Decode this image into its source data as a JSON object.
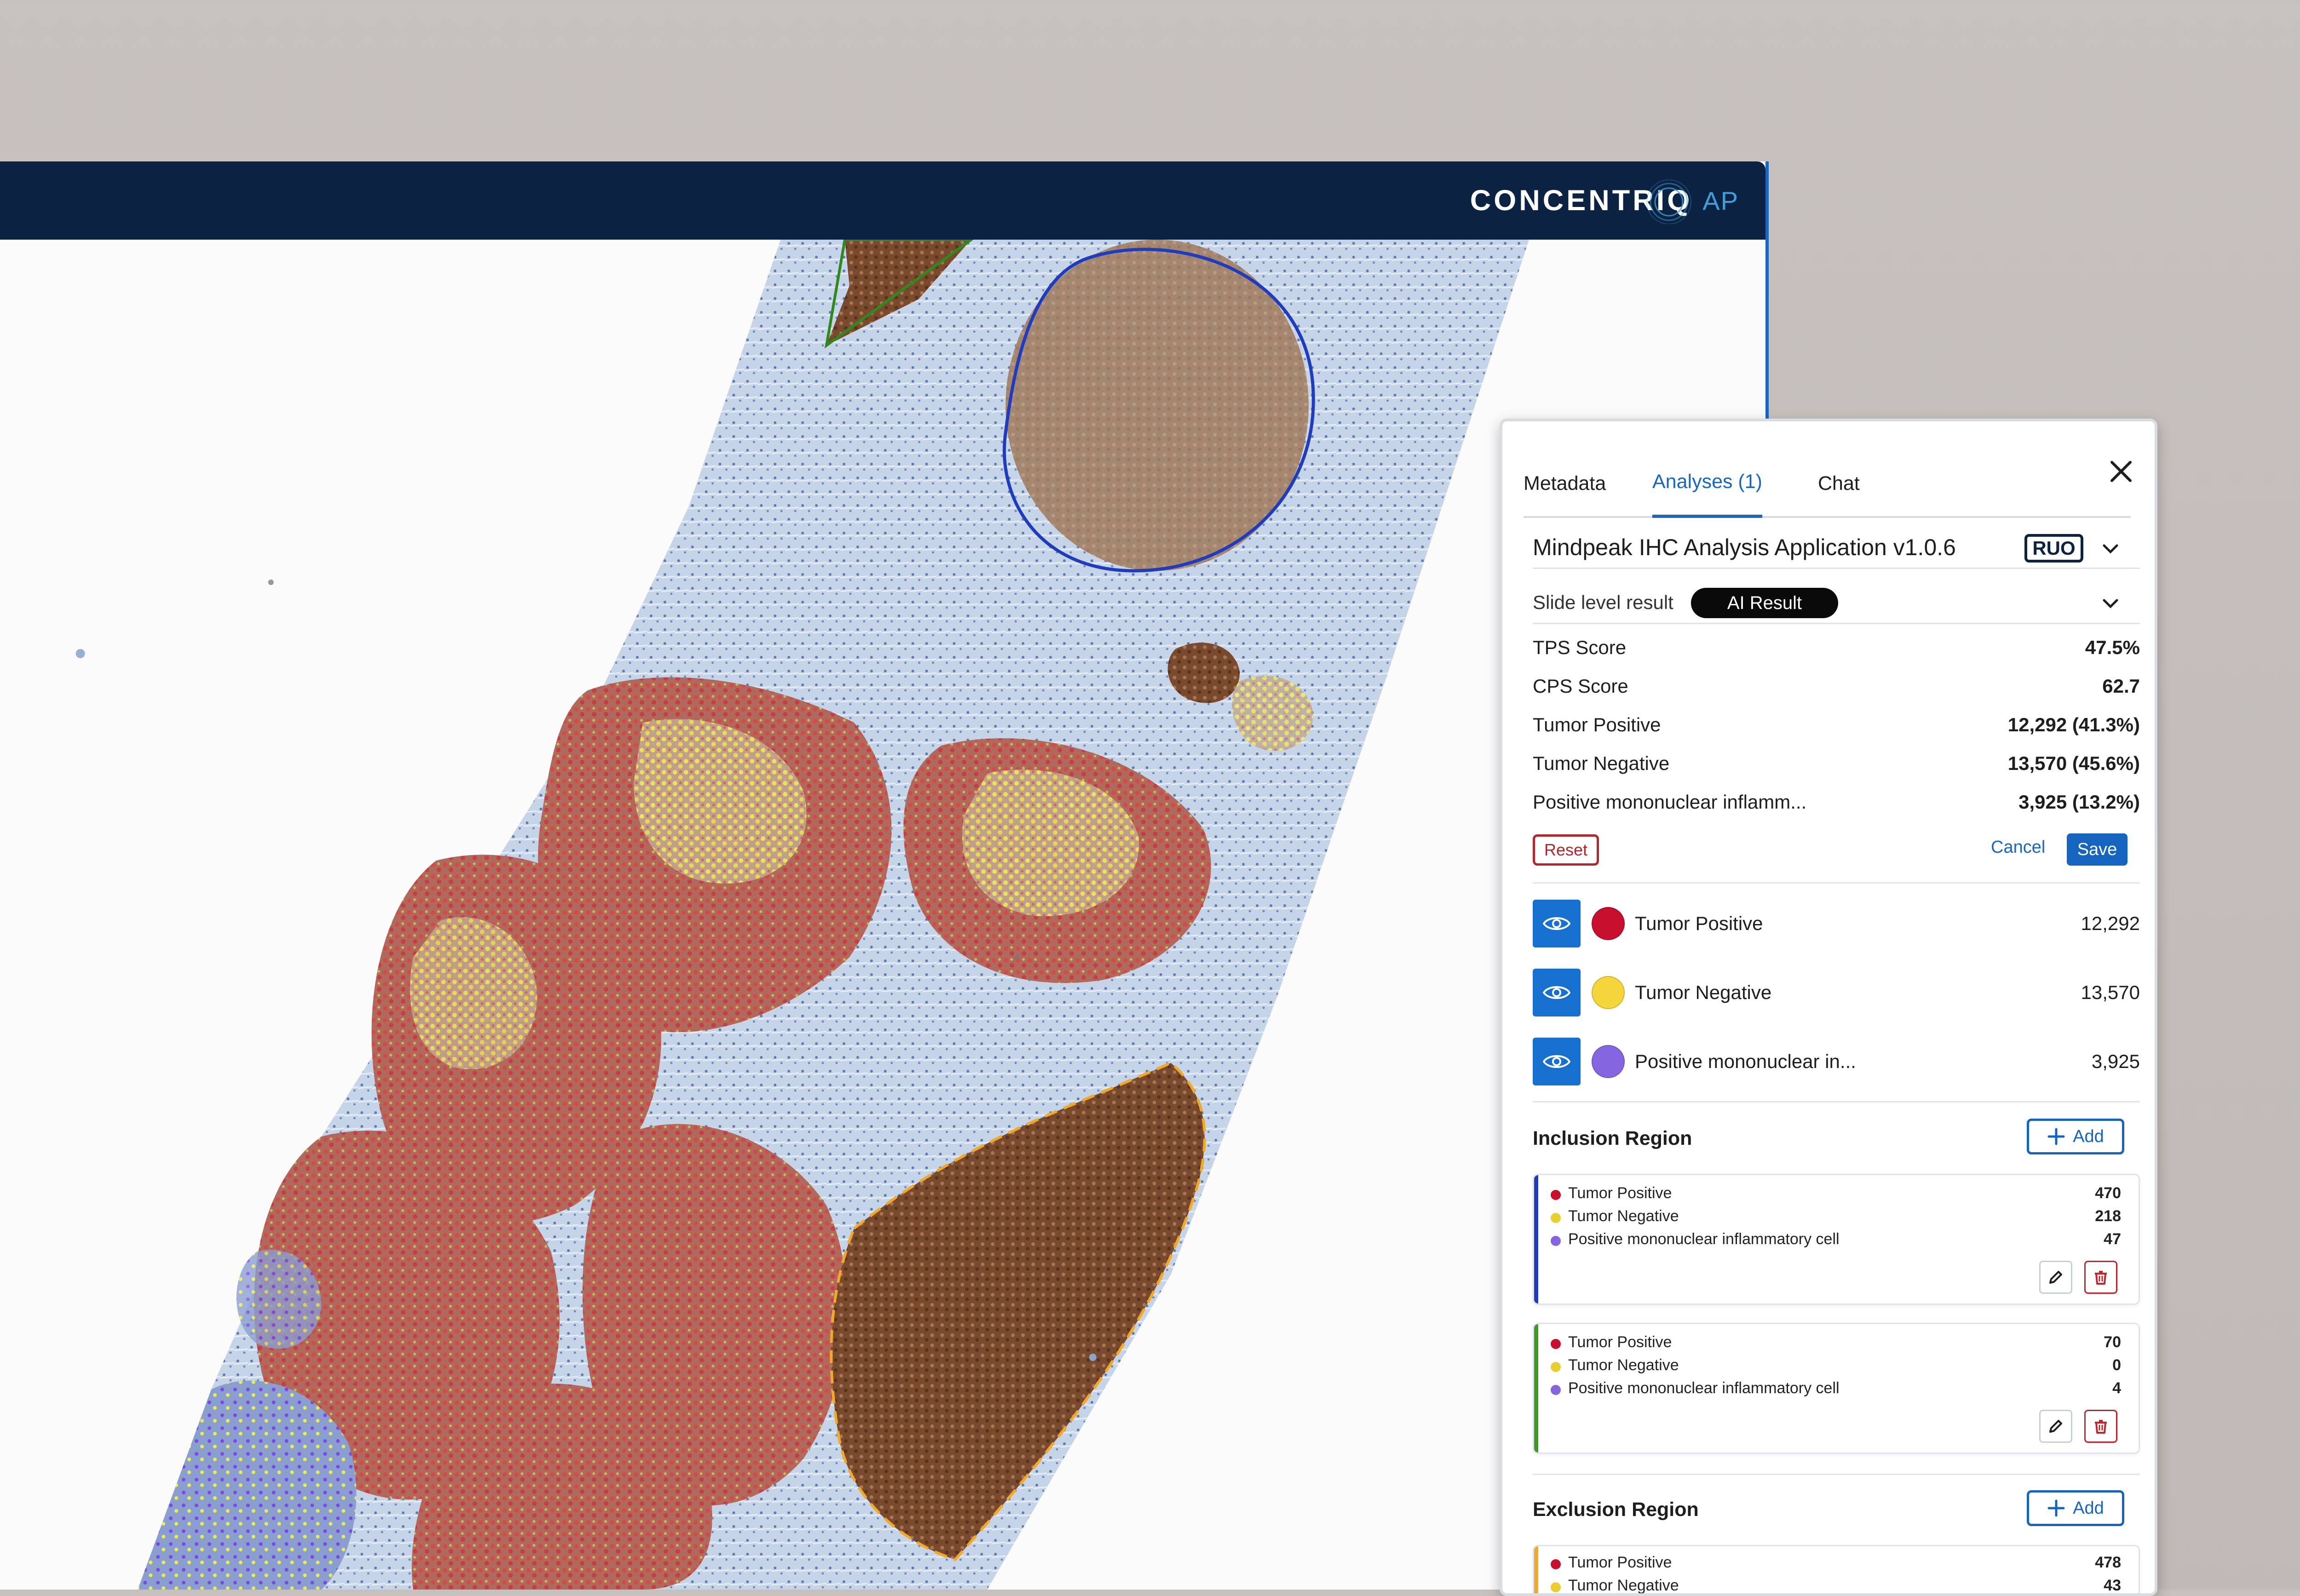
{
  "header": {
    "brand": "CONCENTRIQ",
    "brand_suffix": "AP"
  },
  "panel": {
    "tabs": [
      "Metadata",
      "Analyses (1)",
      "Chat"
    ],
    "active_tab": "Analyses (1)",
    "app_title": "Mindpeak IHC Analysis Application v1.0.6",
    "badge": "RUO",
    "slide_level_label": "Slide level result",
    "ai_result_label": "AI Result",
    "metrics": [
      {
        "label": "TPS Score",
        "value": "47.5%"
      },
      {
        "label": "CPS Score",
        "value": "62.7"
      },
      {
        "label": "Tumor Positive",
        "value": "12,292 (41.3%)"
      },
      {
        "label": "Tumor Negative",
        "value": "13,570 (45.6%)"
      },
      {
        "label": "Positive mononuclear inflamm...",
        "value": "3,925 (13.2%)"
      }
    ],
    "buttons": {
      "reset": "Reset",
      "cancel": "Cancel",
      "save": "Save"
    },
    "legend": [
      {
        "label": "Tumor Positive",
        "count": "12,292",
        "color": "#c8102e"
      },
      {
        "label": "Tumor Negative",
        "count": "13,570",
        "color": "#f4d63a"
      },
      {
        "label": "Positive mononuclear in...",
        "count": "3,925",
        "color": "#8566e0"
      }
    ],
    "inclusion": {
      "title": "Inclusion Region",
      "add_label": "Add",
      "regions": [
        {
          "color": "#1f3cbf",
          "rows": [
            {
              "label": "Tumor Positive",
              "value": "470",
              "color": "#c8102e"
            },
            {
              "label": "Tumor Negative",
              "value": "218",
              "color": "#e8cf2f"
            },
            {
              "label": "Positive mononuclear inflammatory cell",
              "value": "47",
              "color": "#8566e0"
            }
          ]
        },
        {
          "color": "#3e9a20",
          "rows": [
            {
              "label": "Tumor Positive",
              "value": "70",
              "color": "#c8102e"
            },
            {
              "label": "Tumor Negative",
              "value": "0",
              "color": "#e8cf2f"
            },
            {
              "label": "Positive mononuclear inflammatory cell",
              "value": "4",
              "color": "#8566e0"
            }
          ]
        }
      ]
    },
    "exclusion": {
      "title": "Exclusion Region",
      "add_label": "Add",
      "regions": [
        {
          "color": "#f0a92b",
          "rows": [
            {
              "label": "Tumor Positive",
              "value": "478",
              "color": "#c8102e"
            },
            {
              "label": "Tumor Negative",
              "value": "43",
              "color": "#e8cf2f"
            }
          ]
        }
      ]
    }
  },
  "colors": {
    "header_bg": "#0b2242",
    "accent": "#1565c0",
    "danger": "#b3262d"
  }
}
